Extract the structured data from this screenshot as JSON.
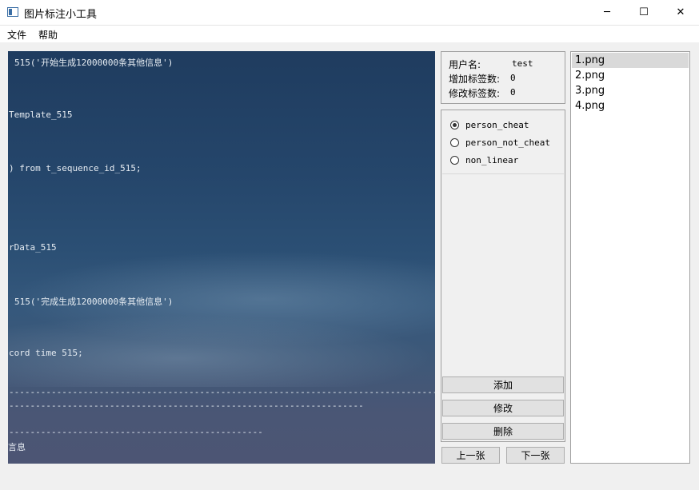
{
  "window": {
    "title": "图片标注小工具",
    "minimize": "─",
    "maximize": "☐",
    "close": "✕"
  },
  "menu": [
    "文件",
    "帮助"
  ],
  "image_text": [
    "515('开始生成12000000条其他信息')",
    "Template_515",
    ") from t_sequence_id_515;",
    "rData_515",
    "515('完成生成12000000条其他信息')",
    "cord time 515;",
    "------------------------------------------------------------------------------------------",
    "-------------------------------------------------------------------",
    "------------------------------------------------",
    "言息"
  ],
  "info": {
    "username_label": "用户名:",
    "username_value": "test",
    "added_label": "增加标签数:",
    "added_value": "0",
    "modified_label": "修改标签数:",
    "modified_value": "0"
  },
  "labels": [
    {
      "text": "person_cheat",
      "checked": true
    },
    {
      "text": "person_not_cheat",
      "checked": false
    },
    {
      "text": "non_linear",
      "checked": false
    }
  ],
  "buttons": {
    "add": "添加",
    "modify": "修改",
    "delete": "删除",
    "prev": "上一张",
    "next": "下一张"
  },
  "files": [
    {
      "name": "1.png",
      "selected": true
    },
    {
      "name": "2.png",
      "selected": false
    },
    {
      "name": "3.png",
      "selected": false
    },
    {
      "name": "4.png",
      "selected": false
    }
  ]
}
